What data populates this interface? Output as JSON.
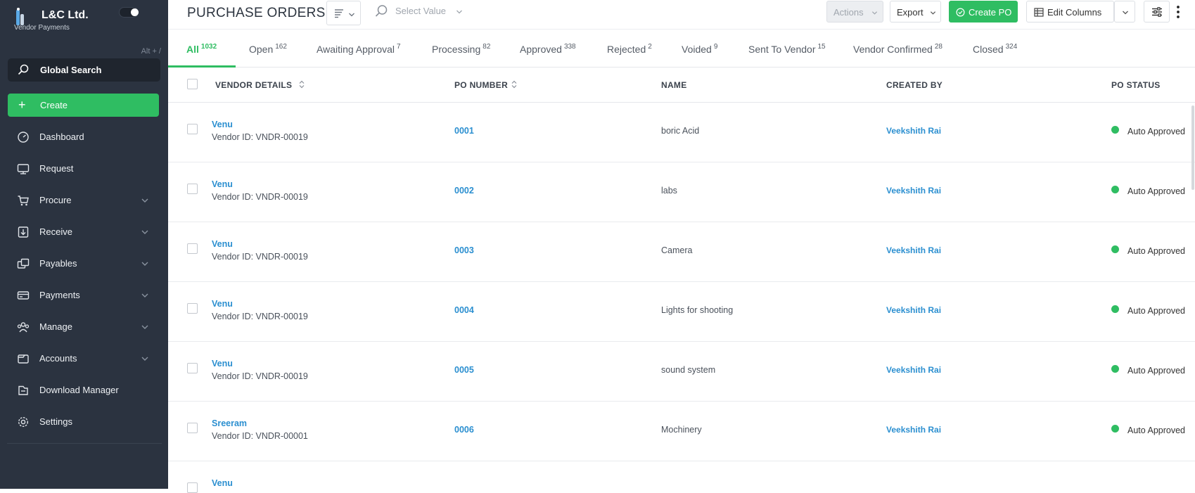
{
  "brand": {
    "name": "L&C Ltd.",
    "subtitle": "Vendor Payments",
    "shortcut": "Alt + /"
  },
  "sidebar": {
    "search_label": "Global Search",
    "create_label": "Create",
    "items": [
      {
        "label": "Dashboard",
        "icon": "dashboard-icon",
        "expandable": false
      },
      {
        "label": "Request",
        "icon": "request-icon",
        "expandable": false
      },
      {
        "label": "Procure",
        "icon": "cart-icon",
        "expandable": true
      },
      {
        "label": "Receive",
        "icon": "receive-icon",
        "expandable": true
      },
      {
        "label": "Payables",
        "icon": "payables-icon",
        "expandable": true
      },
      {
        "label": "Payments",
        "icon": "payments-icon",
        "expandable": true
      },
      {
        "label": "Manage",
        "icon": "manage-icon",
        "expandable": true
      },
      {
        "label": "Accounts",
        "icon": "accounts-icon",
        "expandable": true
      },
      {
        "label": "Download Manager",
        "icon": "download-icon",
        "expandable": false
      },
      {
        "label": "Settings",
        "icon": "settings-icon",
        "expandable": false
      }
    ]
  },
  "header": {
    "title": "PURCHASE ORDERS",
    "select_placeholder": "Select Value",
    "actions_label": "Actions",
    "export_label": "Export",
    "create_po_label": "Create PO",
    "edit_columns_label": "Edit Columns"
  },
  "tabs": [
    {
      "label": "All",
      "count": "1032",
      "active": true
    },
    {
      "label": "Open",
      "count": "162"
    },
    {
      "label": "Awaiting Approval",
      "count": "7"
    },
    {
      "label": "Processing",
      "count": "82"
    },
    {
      "label": "Approved",
      "count": "338"
    },
    {
      "label": "Rejected",
      "count": "2"
    },
    {
      "label": "Voided",
      "count": "9"
    },
    {
      "label": "Sent To Vendor",
      "count": "15"
    },
    {
      "label": "Vendor Confirmed",
      "count": "28"
    },
    {
      "label": "Closed",
      "count": "324"
    }
  ],
  "table": {
    "columns": [
      "VENDOR DETAILS",
      "PO NUMBER",
      "NAME",
      "CREATED BY",
      "PO STATUS"
    ],
    "rows": [
      {
        "vendor": "Venu",
        "vendor_id": "Vendor ID: VNDR-00019",
        "po": "0001",
        "name": "boric Acid",
        "created_by": "Veekshith Rai",
        "status": "Auto Approved"
      },
      {
        "vendor": "Venu",
        "vendor_id": "Vendor ID: VNDR-00019",
        "po": "0002",
        "name": "labs",
        "created_by": "Veekshith Rai",
        "status": "Auto Approved"
      },
      {
        "vendor": "Venu",
        "vendor_id": "Vendor ID: VNDR-00019",
        "po": "0003",
        "name": "Camera",
        "created_by": "Veekshith Rai",
        "status": "Auto Approved"
      },
      {
        "vendor": "Venu",
        "vendor_id": "Vendor ID: VNDR-00019",
        "po": "0004",
        "name": "Lights for shooting",
        "created_by": "Veekshith Rai",
        "status": "Auto Approved"
      },
      {
        "vendor": "Venu",
        "vendor_id": "Vendor ID: VNDR-00019",
        "po": "0005",
        "name": "sound system",
        "created_by": "Veekshith Rai",
        "status": "Auto Approved"
      },
      {
        "vendor": "Sreeram",
        "vendor_id": "Vendor ID: VNDR-00001",
        "po": "0006",
        "name": "Mochinery",
        "created_by": "Veekshith Rai",
        "status": "Auto Approved"
      },
      {
        "vendor": "Venu",
        "vendor_id": "",
        "po": "",
        "name": "",
        "created_by": "",
        "status": ""
      }
    ]
  },
  "colors": {
    "accent": "#2fbd62",
    "link": "#2b8fd0",
    "sidebar": "#2b3340"
  }
}
